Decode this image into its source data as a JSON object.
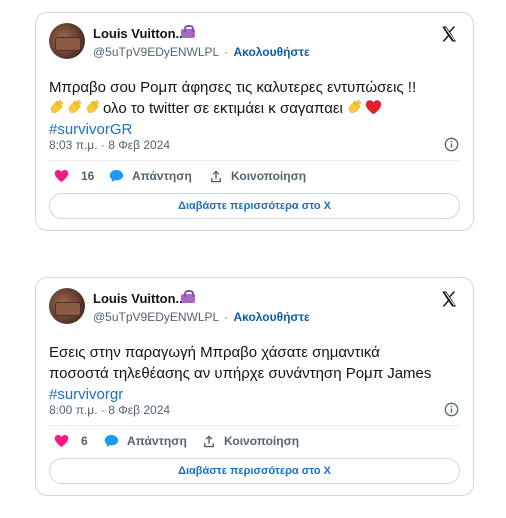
{
  "tweets": [
    {
      "author_name": "Louis Vuitton...",
      "handle": "@5uTpV9EDyENWLPL",
      "separator": "·",
      "follow_label": "Ακολουθήστε",
      "text_line1": "Μπραβο σου  Ρομπ άφησες τις καλυτερες εντυπώσεις !!",
      "text_line2": "ολο το twitter σε εκτιμάει  κ σαγαπαει",
      "hashtag": "#survivorGR",
      "timestamp": "8:03 π.μ. · 8 Φεβ 2024",
      "like_count": "16",
      "reply_label": "Απάντηση",
      "share_label": "Κοινοποίηση",
      "read_more_label": "Διαβάστε περισσότερα στο X"
    },
    {
      "author_name": "Louis Vuitton...",
      "handle": "@5uTpV9EDyENWLPL",
      "separator": "·",
      "follow_label": "Ακολουθήστε",
      "text_line1": "Εσεις στην παραγωγή Μπραβο χάσατε σημαντικά",
      "text_line2": "ποσοστά τηλεθέασης αν υπήρχε συνάντηση Ρομπ James",
      "hashtag": "#survivorgr",
      "timestamp": "8:00 π.μ. · 8 Φεβ 2024",
      "like_count": "6",
      "reply_label": "Απάντηση",
      "share_label": "Κοινοποίηση",
      "read_more_label": "Διαβάστε περισσότερα στο X"
    }
  ],
  "colors": {
    "accent_blue": "#1d6fc0",
    "like_pink": "#f91880",
    "reply_blue": "#1d9bf0",
    "border": "#cfd9de",
    "muted": "#536471"
  },
  "icons": [
    "x-logo-icon",
    "info-icon",
    "heart-icon",
    "reply-bubble-icon",
    "share-upload-icon",
    "clapping-hands-emoji",
    "red-heart-emoji",
    "handbag-emoji"
  ]
}
